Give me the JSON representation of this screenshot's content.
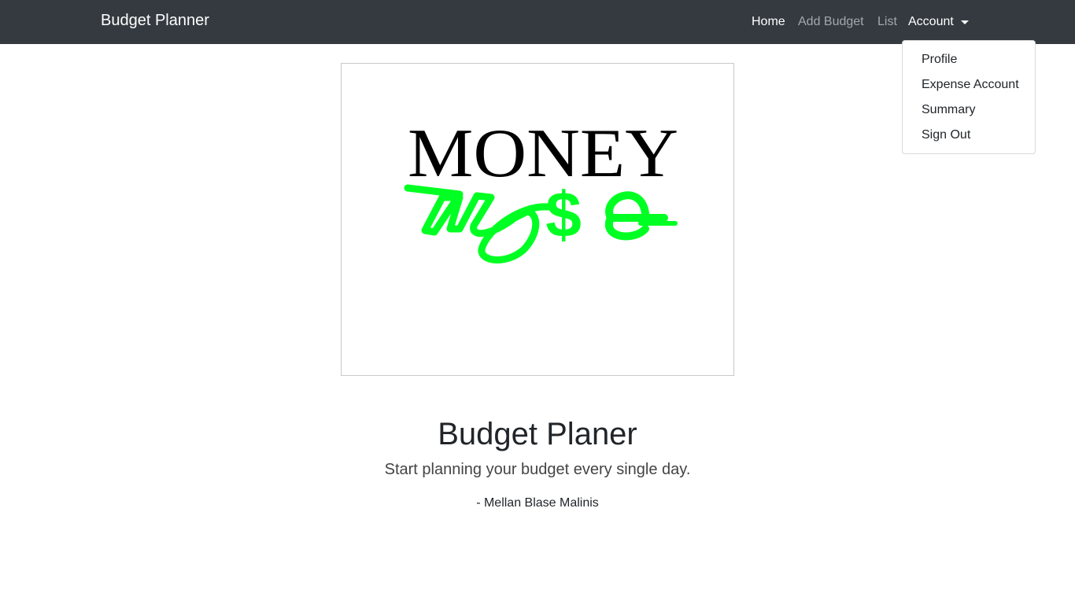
{
  "navbar": {
    "brand": "Budget Planner",
    "links": {
      "home": "Home",
      "add_budget": "Add Budget",
      "list": "List",
      "account": "Account"
    }
  },
  "account_menu": {
    "items": [
      "Profile",
      "Expense Account",
      "Summary",
      "Sign Out"
    ]
  },
  "logo": {
    "line1": "MONEY",
    "line2": "w$e",
    "primary_color": "#000000",
    "accent_color": "#00ff22"
  },
  "hero": {
    "title": "Budget Planer",
    "lead": "Start planning your budget every single day.",
    "author": "- Mellan Blase Malinis"
  },
  "colors": {
    "navbar_bg": "#343a40",
    "nav_active": "#ffffff",
    "nav_muted": "rgba(255,255,255,0.55)"
  }
}
